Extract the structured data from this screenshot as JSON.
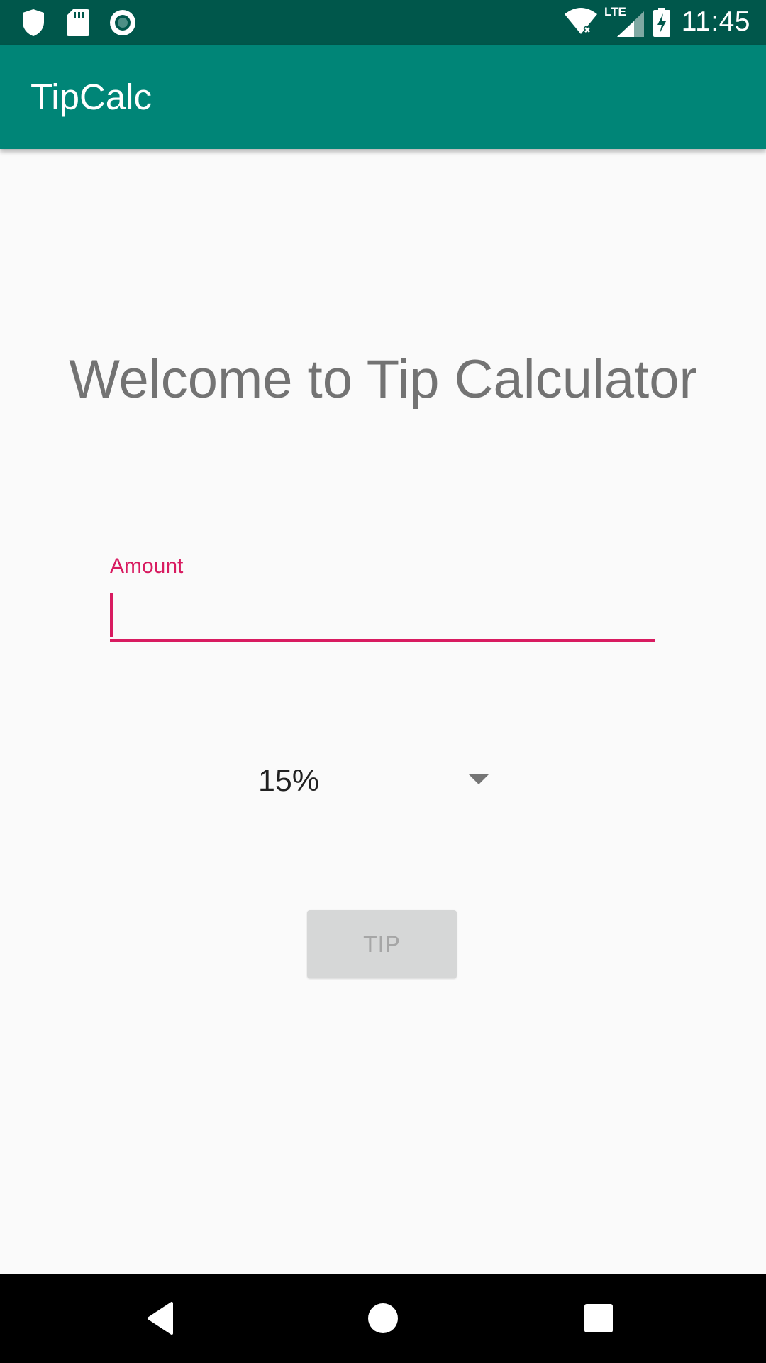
{
  "status_bar": {
    "time": "11:45",
    "icons": [
      "shield-icon",
      "sd-card-icon",
      "sync-circle-icon",
      "wifi-icon",
      "lte-signal-icon",
      "battery-charging-icon"
    ],
    "network_label": "LTE"
  },
  "app_bar": {
    "title": "TipCalc",
    "background": "#008577",
    "status_background": "#00574b"
  },
  "main": {
    "welcome_text": "Welcome to Tip Calculator",
    "amount_field": {
      "label": "Amount",
      "value": "",
      "accent": "#d81b60"
    },
    "tip_spinner": {
      "selected": "15%"
    },
    "tip_button": {
      "label": "TIP",
      "enabled": false
    }
  },
  "nav_bar": {
    "buttons": [
      "back-icon",
      "home-icon",
      "recents-icon"
    ]
  }
}
